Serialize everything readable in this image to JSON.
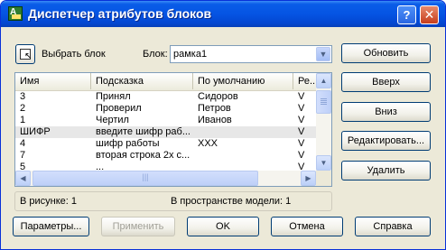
{
  "window": {
    "title": "Диспетчер атрибутов блоков"
  },
  "titlebar": {
    "help_glyph": "?",
    "close_glyph": "✕"
  },
  "toolbar": {
    "select_block_label": "Выбрать блок",
    "block_label": "Блок:",
    "block_value": "рамка1"
  },
  "table": {
    "columns": [
      "Имя",
      "Подсказка",
      "По умолчанию",
      "Ре..."
    ],
    "rows": [
      [
        "3",
        "Принял",
        "Сидоров",
        "V"
      ],
      [
        "2",
        "Проверил",
        "Петров",
        "V"
      ],
      [
        "1",
        "Чертил",
        "Иванов",
        "V"
      ],
      [
        "ШИФР",
        "введите шифр раб...",
        "",
        "V"
      ],
      [
        "4",
        "шифр работы",
        "XXX",
        "V"
      ],
      [
        "7",
        "вторая строка 2х с...",
        "",
        "V"
      ],
      [
        "5",
        "...",
        "",
        "V"
      ]
    ],
    "selected_row": 3
  },
  "status": {
    "in_drawing": "В рисунке: 1",
    "in_model_space": "В пространстве модели: 1"
  },
  "side_buttons": {
    "sync": "Обновить",
    "move_up": "Вверх",
    "move_down": "Вниз",
    "edit": "Редактировать...",
    "remove": "Удалить"
  },
  "bottom_buttons": {
    "settings": "Параметры...",
    "apply": "Применить",
    "ok": "OK",
    "cancel": "Отмена",
    "help": "Справка"
  },
  "colors": {
    "titlebar": "#0554e3",
    "dialog_bg": "#ece9d8",
    "button_border": "#003c74",
    "selected_row": "#e7e7e7"
  }
}
